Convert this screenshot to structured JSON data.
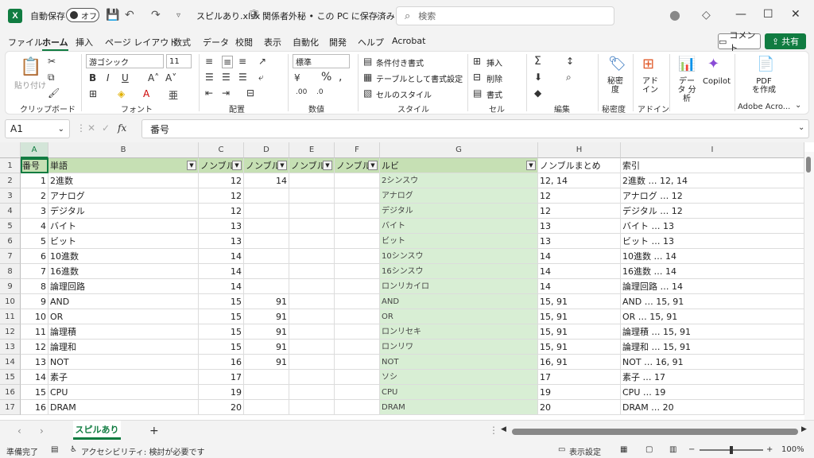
{
  "titlebar": {
    "autosave_label": "自動保存",
    "autosave_state": "オフ",
    "filename": "スピルあり.xlsx",
    "sensitivity": "関係者外秘 • この PC に保存済み",
    "search_placeholder": "検索"
  },
  "menu": {
    "tabs": [
      "ファイル",
      "ホーム",
      "挿入",
      "ページ レイアウト",
      "数式",
      "データ",
      "校閲",
      "表示",
      "自動化",
      "開発",
      "ヘルプ",
      "Acrobat"
    ],
    "comment": "コメント",
    "share": "共有"
  },
  "ribbon": {
    "paste": "貼り付け",
    "clipboard": "クリップボード",
    "font_name": "游ゴシック",
    "font_size": "11",
    "font": "フォント",
    "alignment": "配置",
    "number_format": "標準",
    "number": "数値",
    "cond_format": "条件付き書式",
    "table_format": "テーブルとして書式設定",
    "cell_style": "セルのスタイル",
    "style": "スタイル",
    "insert": "挿入",
    "delete": "削除",
    "format": "書式",
    "cells": "セル",
    "editing": "編集",
    "sensitivity": "秘密度",
    "sensitivity_group": "秘密度",
    "addin": "アド イン",
    "addin_group": "アドイン",
    "data_analysis": "データ 分析",
    "copilot": "Copilot",
    "pdf_create": "PDF を作成",
    "adobe": "Adobe Acro..."
  },
  "formula_bar": {
    "name_box": "A1",
    "fx": "fx",
    "content": "番号"
  },
  "columns": [
    "A",
    "B",
    "C",
    "D",
    "E",
    "F",
    "G",
    "H",
    "I"
  ],
  "header_row": [
    "番号",
    "単語",
    "ノンブル",
    "ノンブル",
    "ノンブル",
    "ノンブル",
    "ルビ",
    "ノンブルまとめ",
    "索引"
  ],
  "rows": [
    [
      "1",
      "2進数",
      "12",
      "14",
      "",
      "",
      "2シンスウ",
      "12, 14",
      "2進数 … 12, 14"
    ],
    [
      "2",
      "アナログ",
      "12",
      "",
      "",
      "",
      "アナログ",
      "12",
      "アナログ … 12"
    ],
    [
      "3",
      "デジタル",
      "12",
      "",
      "",
      "",
      "デジタル",
      "12",
      "デジタル … 12"
    ],
    [
      "4",
      "バイト",
      "13",
      "",
      "",
      "",
      "バイト",
      "13",
      "バイト … 13"
    ],
    [
      "5",
      "ビット",
      "13",
      "",
      "",
      "",
      "ビット",
      "13",
      "ビット … 13"
    ],
    [
      "6",
      "10進数",
      "14",
      "",
      "",
      "",
      "10シンスウ",
      "14",
      "10進数 … 14"
    ],
    [
      "7",
      "16進数",
      "14",
      "",
      "",
      "",
      "16シンスウ",
      "14",
      "16進数 … 14"
    ],
    [
      "8",
      "論理回路",
      "14",
      "",
      "",
      "",
      "ロンリカイロ",
      "14",
      "論理回路 … 14"
    ],
    [
      "9",
      "AND",
      "15",
      "91",
      "",
      "",
      "AND",
      "15, 91",
      "AND … 15, 91"
    ],
    [
      "10",
      "OR",
      "15",
      "91",
      "",
      "",
      "OR",
      "15, 91",
      "OR … 15, 91"
    ],
    [
      "11",
      "論理積",
      "15",
      "91",
      "",
      "",
      "ロンリセキ",
      "15, 91",
      "論理積 … 15, 91"
    ],
    [
      "12",
      "論理和",
      "15",
      "91",
      "",
      "",
      "ロンリワ",
      "15, 91",
      "論理和 … 15, 91"
    ],
    [
      "13",
      "NOT",
      "16",
      "91",
      "",
      "",
      "NOT",
      "16, 91",
      "NOT … 16, 91"
    ],
    [
      "14",
      "素子",
      "17",
      "",
      "",
      "",
      "ソシ",
      "17",
      "素子 … 17"
    ],
    [
      "15",
      "CPU",
      "19",
      "",
      "",
      "",
      "CPU",
      "19",
      "CPU … 19"
    ],
    [
      "16",
      "DRAM",
      "20",
      "",
      "",
      "",
      "DRAM",
      "20",
      "DRAM … 20"
    ]
  ],
  "sheet": {
    "tab": "スピルあり",
    "add": "+"
  },
  "status": {
    "ready": "準備完了",
    "accessibility": "アクセシビリティ: 検討が必要です",
    "display_settings": "表示設定",
    "zoom": "100%"
  }
}
